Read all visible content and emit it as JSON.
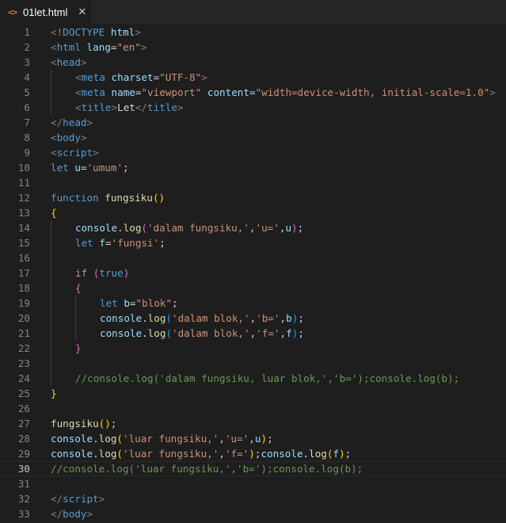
{
  "tab": {
    "icon": "html-file-icon",
    "filename": "01let.html",
    "close": "✕"
  },
  "current_line": 30,
  "lines": [
    {
      "n": "1",
      "tokens": [
        [
          "br",
          "<"
        ],
        [
          "tag",
          "!DOCTYPE"
        ],
        [
          "txt",
          " "
        ],
        [
          "attr",
          "html"
        ],
        [
          "br",
          ">"
        ]
      ]
    },
    {
      "n": "2",
      "tokens": [
        [
          "br",
          "<"
        ],
        [
          "tag",
          "html"
        ],
        [
          "txt",
          " "
        ],
        [
          "attr",
          "lang"
        ],
        [
          "txt",
          "="
        ],
        [
          "str",
          "\"en\""
        ],
        [
          "br",
          ">"
        ]
      ]
    },
    {
      "n": "3",
      "tokens": [
        [
          "br",
          "<"
        ],
        [
          "tag",
          "head"
        ],
        [
          "br",
          ">"
        ]
      ]
    },
    {
      "n": "4",
      "indent": 1,
      "tokens": [
        [
          "br",
          "<"
        ],
        [
          "tag",
          "meta"
        ],
        [
          "txt",
          " "
        ],
        [
          "attr",
          "charset"
        ],
        [
          "txt",
          "="
        ],
        [
          "str",
          "\"UTF-8\""
        ],
        [
          "br",
          ">"
        ]
      ]
    },
    {
      "n": "5",
      "indent": 1,
      "tokens": [
        [
          "br",
          "<"
        ],
        [
          "tag",
          "meta"
        ],
        [
          "txt",
          " "
        ],
        [
          "attr",
          "name"
        ],
        [
          "txt",
          "="
        ],
        [
          "str",
          "\"viewport\""
        ],
        [
          "txt",
          " "
        ],
        [
          "attr",
          "content"
        ],
        [
          "txt",
          "="
        ],
        [
          "str",
          "\"width=device-width, initial-scale=1.0\""
        ],
        [
          "br",
          ">"
        ]
      ]
    },
    {
      "n": "6",
      "indent": 1,
      "tokens": [
        [
          "br",
          "<"
        ],
        [
          "tag",
          "title"
        ],
        [
          "br",
          ">"
        ],
        [
          "txt",
          "Let"
        ],
        [
          "br",
          "</"
        ],
        [
          "tag",
          "title"
        ],
        [
          "br",
          ">"
        ]
      ]
    },
    {
      "n": "7",
      "tokens": [
        [
          "br",
          "</"
        ],
        [
          "tag",
          "head"
        ],
        [
          "br",
          ">"
        ]
      ]
    },
    {
      "n": "8",
      "tokens": [
        [
          "br",
          "<"
        ],
        [
          "tag",
          "body"
        ],
        [
          "br",
          ">"
        ]
      ]
    },
    {
      "n": "9",
      "tokens": [
        [
          "br",
          "<"
        ],
        [
          "tag",
          "script"
        ],
        [
          "br",
          ">"
        ]
      ]
    },
    {
      "n": "10",
      "tokens": [
        [
          "kw",
          "let"
        ],
        [
          "txt",
          " "
        ],
        [
          "var",
          "u"
        ],
        [
          "txt",
          "="
        ],
        [
          "str",
          "'umum'"
        ],
        [
          "txt",
          ";"
        ]
      ]
    },
    {
      "n": "11",
      "tokens": []
    },
    {
      "n": "12",
      "tokens": [
        [
          "kw",
          "function"
        ],
        [
          "txt",
          " "
        ],
        [
          "fn",
          "fungsiku"
        ],
        [
          "p1",
          "()"
        ]
      ]
    },
    {
      "n": "13",
      "tokens": [
        [
          "p1",
          "{"
        ]
      ]
    },
    {
      "n": "14",
      "indent": 1,
      "tokens": [
        [
          "var",
          "console"
        ],
        [
          "txt",
          "."
        ],
        [
          "fn",
          "log"
        ],
        [
          "p2",
          "("
        ],
        [
          "str",
          "'dalam fungsiku,'"
        ],
        [
          "txt",
          ","
        ],
        [
          "str",
          "'u='"
        ],
        [
          "txt",
          ","
        ],
        [
          "var",
          "u"
        ],
        [
          "p2",
          ")"
        ],
        [
          "txt",
          ";"
        ]
      ]
    },
    {
      "n": "15",
      "indent": 1,
      "tokens": [
        [
          "kw",
          "let"
        ],
        [
          "txt",
          " "
        ],
        [
          "var",
          "f"
        ],
        [
          "txt",
          "="
        ],
        [
          "str",
          "'fungsi'"
        ],
        [
          "txt",
          ";"
        ]
      ]
    },
    {
      "n": "16",
      "tokens": []
    },
    {
      "n": "17",
      "indent": 1,
      "tokens": [
        [
          "ctl",
          "if"
        ],
        [
          "txt",
          " "
        ],
        [
          "p2",
          "("
        ],
        [
          "kw",
          "true"
        ],
        [
          "p2",
          ")"
        ]
      ]
    },
    {
      "n": "18",
      "indent": 1,
      "tokens": [
        [
          "p2",
          "{"
        ]
      ]
    },
    {
      "n": "19",
      "indent": 2,
      "tokens": [
        [
          "kw",
          "let"
        ],
        [
          "txt",
          " "
        ],
        [
          "var",
          "b"
        ],
        [
          "txt",
          "="
        ],
        [
          "str",
          "\"blok\""
        ],
        [
          "txt",
          ";"
        ]
      ]
    },
    {
      "n": "20",
      "indent": 2,
      "tokens": [
        [
          "var",
          "console"
        ],
        [
          "txt",
          "."
        ],
        [
          "fn",
          "log"
        ],
        [
          "p3",
          "("
        ],
        [
          "str",
          "'dalam blok,'"
        ],
        [
          "txt",
          ","
        ],
        [
          "str",
          "'b='"
        ],
        [
          "txt",
          ","
        ],
        [
          "var",
          "b"
        ],
        [
          "p3",
          ")"
        ],
        [
          "txt",
          ";"
        ]
      ]
    },
    {
      "n": "21",
      "indent": 2,
      "tokens": [
        [
          "var",
          "console"
        ],
        [
          "txt",
          "."
        ],
        [
          "fn",
          "log"
        ],
        [
          "p3",
          "("
        ],
        [
          "str",
          "'dalam blok,'"
        ],
        [
          "txt",
          ","
        ],
        [
          "str",
          "'f='"
        ],
        [
          "txt",
          ","
        ],
        [
          "var",
          "f"
        ],
        [
          "p3",
          ")"
        ],
        [
          "txt",
          ";"
        ]
      ]
    },
    {
      "n": "22",
      "indent": 1,
      "tokens": [
        [
          "p2",
          "}"
        ]
      ]
    },
    {
      "n": "23",
      "tokens": []
    },
    {
      "n": "24",
      "indent": 1,
      "tokens": [
        [
          "com",
          "//console.log('dalam fungsiku, luar blok,','b=');console.log(b);"
        ]
      ]
    },
    {
      "n": "25",
      "tokens": [
        [
          "p1",
          "}"
        ]
      ]
    },
    {
      "n": "26",
      "tokens": []
    },
    {
      "n": "27",
      "tokens": [
        [
          "fn",
          "fungsiku"
        ],
        [
          "p1",
          "()"
        ],
        [
          "txt",
          ";"
        ]
      ]
    },
    {
      "n": "28",
      "tokens": [
        [
          "var",
          "console"
        ],
        [
          "txt",
          "."
        ],
        [
          "fn",
          "log"
        ],
        [
          "p1",
          "("
        ],
        [
          "str",
          "'luar fungsiku,'"
        ],
        [
          "txt",
          ","
        ],
        [
          "str",
          "'u='"
        ],
        [
          "txt",
          ","
        ],
        [
          "var",
          "u"
        ],
        [
          "p1",
          ")"
        ],
        [
          "txt",
          ";"
        ]
      ]
    },
    {
      "n": "29",
      "tokens": [
        [
          "var",
          "console"
        ],
        [
          "txt",
          "."
        ],
        [
          "fn",
          "log"
        ],
        [
          "p1",
          "("
        ],
        [
          "str",
          "'luar fungsiku,'"
        ],
        [
          "txt",
          ","
        ],
        [
          "str",
          "'f='"
        ],
        [
          "p1",
          ")"
        ],
        [
          "txt",
          ";"
        ],
        [
          "var",
          "console"
        ],
        [
          "txt",
          "."
        ],
        [
          "fn",
          "log"
        ],
        [
          "p1",
          "("
        ],
        [
          "var",
          "f"
        ],
        [
          "p1",
          ")"
        ],
        [
          "txt",
          ";"
        ]
      ]
    },
    {
      "n": "30",
      "tokens": [
        [
          "com",
          "//console.log('luar fungsiku,','b=');console.log(b);"
        ]
      ]
    },
    {
      "n": "31",
      "tokens": []
    },
    {
      "n": "32",
      "tokens": [
        [
          "br",
          "</"
        ],
        [
          "tag",
          "script"
        ],
        [
          "br",
          ">"
        ]
      ]
    },
    {
      "n": "33",
      "tokens": [
        [
          "br",
          "</"
        ],
        [
          "tag",
          "body"
        ],
        [
          "br",
          ">"
        ]
      ]
    }
  ],
  "colors": {
    "background": "#1e1e1e",
    "tabbar": "#252526",
    "keyword": "#569cd6",
    "string": "#ce9178",
    "function": "#dcdcaa",
    "variable": "#9cdcfe",
    "comment": "#6a9955",
    "control": "#c586c0"
  }
}
